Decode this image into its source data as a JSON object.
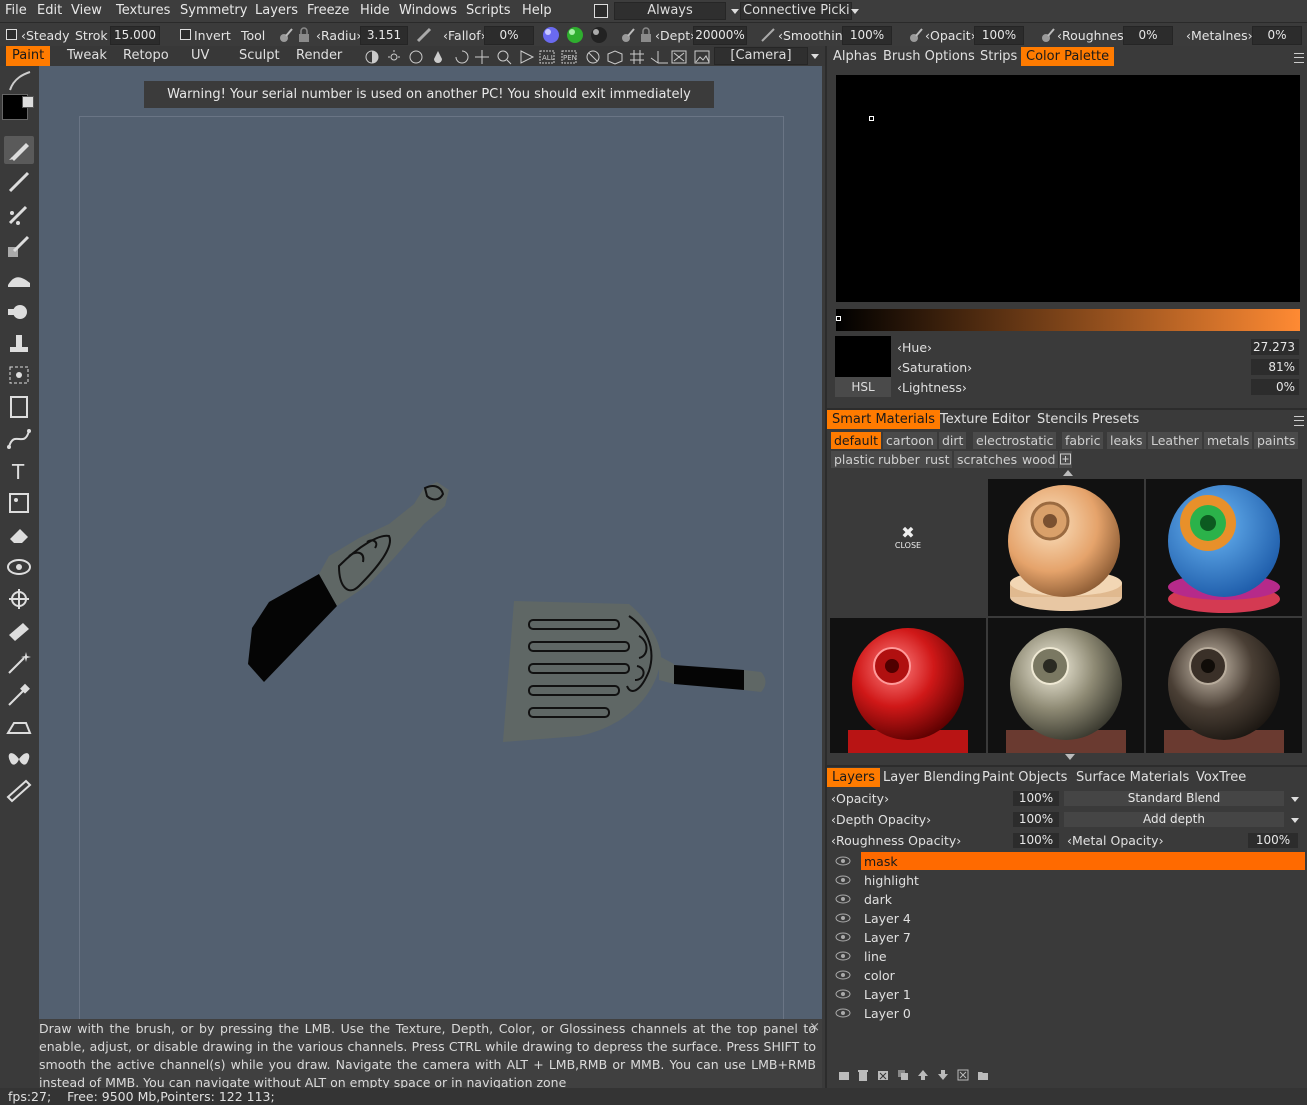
{
  "menu": [
    "File",
    "Edit",
    "View",
    "Textures",
    "Symmetry",
    "Layers",
    "Freeze",
    "Hide",
    "Windows",
    "Scripts",
    "Help"
  ],
  "menubar_extra": {
    "always_label": "Always",
    "connective_label": "Connective Picki"
  },
  "options": {
    "steady_label": "Steady",
    "stroke_label": "Strok",
    "stroke_value": "15.000",
    "invert_label": "Invert",
    "tool_label": "Tool",
    "radius_label": "Radiu",
    "radius_value": "3.151",
    "falloff_label": "Fallof",
    "falloff_value": "0%",
    "depth_label": "Dept",
    "depth_value": "20000%",
    "smoothing_label": "Smoothin",
    "smoothing_value": "100%",
    "opacity_label": "Opacit",
    "opacity_value": "100%",
    "roughness_label": "Roughnes",
    "roughness_value": "0%",
    "metalness_label": "Metalnes",
    "metalness_value": "0%"
  },
  "rooms": {
    "paint": "Paint",
    "tweak": "Tweak",
    "retopo": "Retopo",
    "uv": "UV",
    "sculpt": "Sculpt",
    "render": "Render",
    "camera": "[Camera]"
  },
  "viewport": {
    "warning": "Warning! Your serial number is used on another PC! You should exit immediately",
    "hint": "Draw with the brush, or by pressing the LMB. Use the Texture, Depth, Color, or Glossiness channels at the top panel to enable, adjust, or disable drawing in the various channels. Press CTRL while drawing to depress the surface. Press SHIFT to smooth the active channel(s) while you draw. Navigate the camera with ALT + LMB,RMB or MMB. You can use LMB+RMB instead of MMB. You can navigate without ALT on empty space or in navigation zone",
    "hint_close": "×"
  },
  "status": {
    "text": "fps:27;    Free: 9500 Mb,Pointers: 122 113;"
  },
  "color_panel": {
    "tabs": [
      "Alphas",
      "Brush Options",
      "Strips",
      "Color Palette"
    ],
    "active_tab": "Color Palette",
    "hue_label": "Hue",
    "hue_value": "27.273",
    "saturation_label": "Saturation",
    "saturation_value": "81%",
    "lightness_label": "Lightness",
    "lightness_value": "0%",
    "mode": "HSL",
    "current_color": "#000000",
    "gradient_end_color": "#ff8a33"
  },
  "materials_panel": {
    "tabs": [
      "Smart Materials",
      "Texture Editor",
      "Stencils",
      "Presets"
    ],
    "active_tab": "Smart Materials",
    "tags_row1": [
      "default",
      "cartoon",
      "dirt",
      "electrostatic",
      "fabric",
      "leaks",
      "Leather",
      "metals",
      "paints"
    ],
    "tags_row2": [
      "plastic",
      "rubber",
      "rust",
      "scratches",
      "wood"
    ],
    "close_label": "CLOSE",
    "close_glyph": "✖"
  },
  "layers_panel": {
    "tabs": [
      "Layers",
      "Layer Blending",
      "Paint Objects",
      "Surface Materials",
      "VoxTree"
    ],
    "active_tab": "Layers",
    "opacity_label": "Opacity",
    "opacity_value": "100%",
    "blend_mode": "Standard Blend",
    "depth_opacity_label": "Depth Opacity",
    "depth_opacity_value": "100%",
    "depth_mode": "Add depth",
    "roughness_opacity_label": "Roughness Opacity",
    "roughness_opacity_value": "100%",
    "metal_opacity_label": "Metal Opacity",
    "metal_opacity_value": "100%",
    "layers": [
      {
        "name": "mask",
        "active": true
      },
      {
        "name": "highlight",
        "active": false
      },
      {
        "name": "dark",
        "active": false
      },
      {
        "name": "Layer 4",
        "active": false
      },
      {
        "name": "Layer 7",
        "active": false
      },
      {
        "name": "line",
        "active": false
      },
      {
        "name": "color",
        "active": false
      },
      {
        "name": "Layer 1",
        "active": false
      },
      {
        "name": "Layer 0",
        "active": false
      }
    ]
  },
  "colors": {
    "accent": "#ff7b00",
    "viewport_bg": "#536070"
  }
}
